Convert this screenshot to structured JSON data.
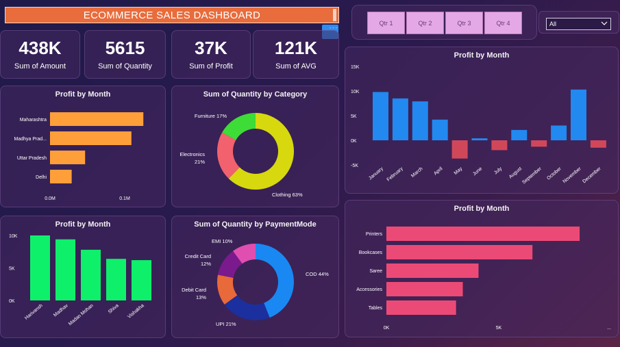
{
  "header": {
    "title": "ECOMMERCE SALES DASHBOARD"
  },
  "kpis": [
    {
      "value": "438K",
      "label": "Sum of Amount"
    },
    {
      "value": "5615",
      "label": "Sum of Quantity"
    },
    {
      "value": "37K",
      "label": "Sum of Profit"
    },
    {
      "value": "121K",
      "label": "Sum of AVG"
    }
  ],
  "quarters": [
    "Qtr 1",
    "Qtr 2",
    "Qtr 3",
    "Qtr 4"
  ],
  "slicer": {
    "selected": "All"
  },
  "icons": {
    "dropdown": "chevron-down-icon"
  },
  "colors": {
    "orange": "#ff9f3a",
    "green": "#0ef06a",
    "blue": "#2189f0",
    "negative": "#d1475a",
    "pink": "#ec4a76"
  },
  "chart_data": [
    {
      "id": "state_profit",
      "type": "bar",
      "orientation": "horizontal",
      "title": "Profit by Month",
      "categories": [
        "Maharashtra",
        "Madhya Prad...",
        "Uttar Pradesh",
        "Delhi"
      ],
      "values": [
        0.125,
        0.109,
        0.047,
        0.029
      ],
      "xticks": [
        "0.0M",
        "0.1M"
      ],
      "xlim": [
        0,
        0.1
      ]
    },
    {
      "id": "category_qty",
      "type": "pie",
      "donut": true,
      "title": "Sum of Quantity by Category",
      "labels": [
        "Clothing",
        "Electronics",
        "Furniture"
      ],
      "values": [
        63,
        21,
        17
      ],
      "display": [
        "Clothing 63%",
        "Electronics 21%",
        "Furniture 17%"
      ],
      "colors": [
        "#d7d80e",
        "#f2616e",
        "#3ddc36"
      ]
    },
    {
      "id": "customer_profit",
      "type": "bar",
      "title": "Profit by Month",
      "categories": [
        "Harivansh",
        "Madhav",
        "Madan Mohan",
        "Shiva",
        "Vishakha"
      ],
      "values": [
        10000,
        9400,
        7800,
        6400,
        6200
      ],
      "yticks": [
        "10K",
        "5K",
        "0K"
      ],
      "ylim": [
        0,
        10000
      ]
    },
    {
      "id": "payment_qty",
      "type": "pie",
      "donut": true,
      "title": "Sum of Quantity by PaymentMode",
      "labels": [
        "COD",
        "UPI",
        "Debit Card",
        "Credit Card",
        "EMI"
      ],
      "values": [
        44,
        21,
        13,
        12,
        10
      ],
      "display": [
        "COD 44%",
        "UPI 21%",
        "Debit Card 13%",
        "Credit Card 12%",
        "EMI 10%"
      ],
      "colors": [
        "#1a88f2",
        "#1c2f9e",
        "#e8693a",
        "#7a1a8c",
        "#e04fb0"
      ]
    },
    {
      "id": "monthly_profit",
      "type": "bar",
      "title": "Profit by Month",
      "categories": [
        "January",
        "February",
        "March",
        "April",
        "May",
        "June",
        "July",
        "August",
        "September",
        "October",
        "November",
        "December"
      ],
      "values": [
        9800,
        8500,
        7900,
        4200,
        -3700,
        400,
        -2000,
        2100,
        -1300,
        3000,
        10300,
        -1500
      ],
      "yticks": [
        "15K",
        "10K",
        "5K",
        "0K",
        "-5K"
      ],
      "ylim": [
        -5000,
        15000
      ]
    },
    {
      "id": "subcategory_profit",
      "type": "bar",
      "orientation": "horizontal",
      "title": "Profit by Month",
      "categories": [
        "Printers",
        "Bookcases",
        "Saree",
        "Accessories",
        "Tables"
      ],
      "values": [
        8600,
        6500,
        4100,
        3400,
        3100
      ],
      "xticks": [
        "0K",
        "5K",
        "..."
      ],
      "xlim": [
        0,
        5000
      ]
    }
  ]
}
